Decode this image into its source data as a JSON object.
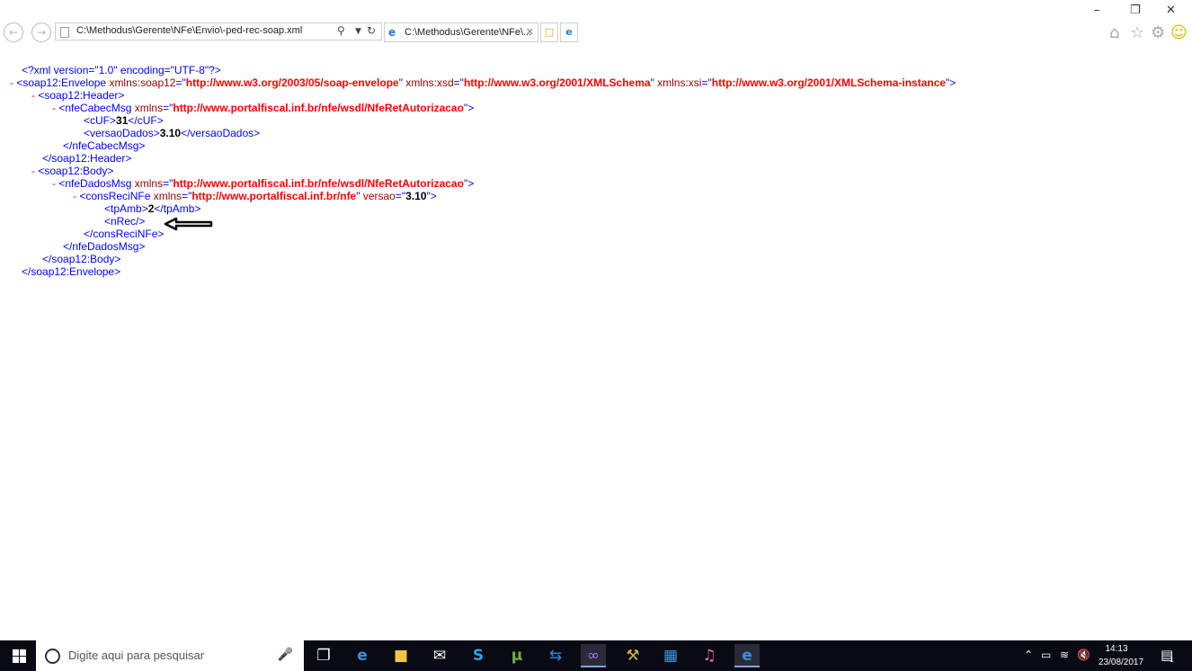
{
  "browser": {
    "address": "C:\\Methodus\\Gerente\\NFe\\Envio\\-ped-rec-soap.xml",
    "tab_title": "C:\\Methodus\\Gerente\\NFe\\...",
    "icons": [
      "back-icon",
      "forward-icon",
      "page-icon",
      "search-icon",
      "dropdown-icon",
      "refresh-icon",
      "ie-icon",
      "close-icon",
      "new-tab-icon",
      "home-icon",
      "favorites-icon",
      "settings-icon",
      "smiley-icon"
    ]
  },
  "xml": {
    "decl": "<?xml version=\"1.0\" encoding=\"UTF-8\"?>",
    "minus": "-",
    "envelope_open_1": "<soap12:Envelope",
    "attr_soap12": "xmlns:soap12",
    "val_soap12": "http://www.w3.org/2003/05/soap-envelope",
    "attr_xsd": "xmlns:xsd",
    "val_xsd": "http://www.w3.org/2001/XMLSchema",
    "attr_xsi": "xmlns:xsi",
    "val_xsi": "http://www.w3.org/2001/XMLSchema-instance",
    "header_open": "<soap12:Header>",
    "cabec_open": "<nfeCabecMsg",
    "attr_xmlns": "xmlns",
    "val_wsdl": "http://www.portalfiscal.inf.br/nfe/wsdl/NfeRetAutorizacao",
    "cuf_open": "<cUF>",
    "cuf_val": "31",
    "cuf_close": "</cUF>",
    "versao_open": "<versaoDados>",
    "versao_val": "3.10",
    "versao_close": "</versaoDados>",
    "cabec_close": "</nfeCabecMsg>",
    "header_close": "</soap12:Header>",
    "body_open": "<soap12:Body>",
    "dados_open": "<nfeDadosMsg",
    "cons_open": "<consReciNFe",
    "val_nfe": "http://www.portalfiscal.inf.br/nfe",
    "attr_versao": "versao",
    "val_versao": "3.10",
    "tpamb_open": "<tpAmb>",
    "tpamb_val": "2",
    "tpamb_close": "</tpAmb>",
    "nrec": "<nRec/>",
    "cons_close": "</consReciNFe>",
    "dados_close": "</nfeDadosMsg>",
    "body_close": "</soap12:Body>",
    "envelope_close": "</soap12:Envelope>",
    "eq_q": "=\"",
    "q_gt": "\">",
    "q": "\"",
    "q_sp": "\" ",
    "gt": ">"
  },
  "taskbar": {
    "search_placeholder": "Digite aqui para pesquisar",
    "apps": [
      "task-view-icon",
      "edge-icon",
      "file-explorer-icon",
      "mail-icon",
      "skype-icon",
      "utorrent-icon",
      "teamviewer-icon",
      "visual-studio-icon",
      "tools-icon",
      "remote-icon",
      "itunes-icon",
      "internet-explorer-icon"
    ],
    "time": "14:13",
    "date": "23/08/2017",
    "notification_count": "1"
  }
}
